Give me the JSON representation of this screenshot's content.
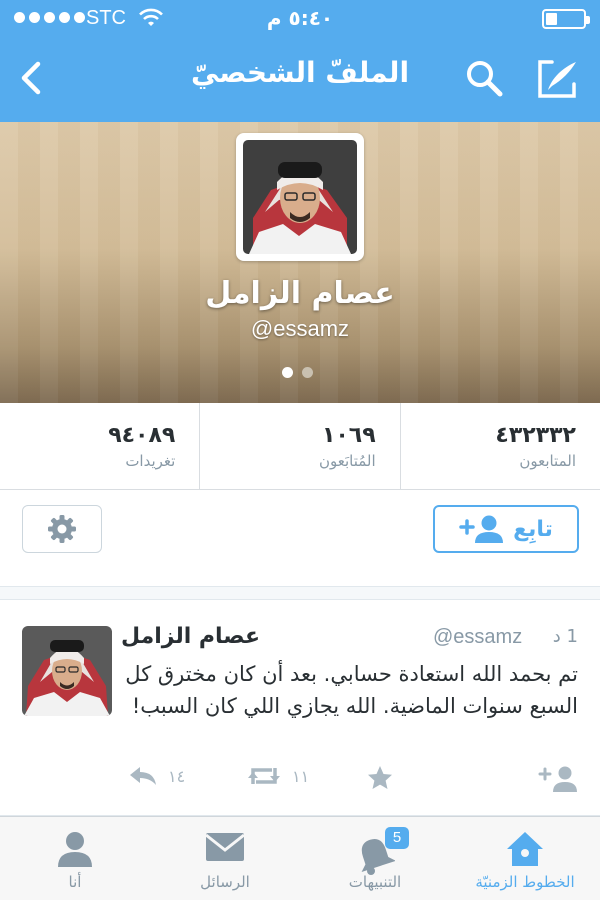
{
  "status_bar": {
    "carrier": "STC",
    "time": "٥:٤٠ م"
  },
  "nav": {
    "title": "الملفّ الشخصيّ",
    "back_icon": "chevron-left-icon",
    "search_icon": "search-icon",
    "compose_icon": "compose-icon"
  },
  "profile": {
    "display_name": "عصام الزامل",
    "handle": "@essamz",
    "pager_active_color": "#ffffff",
    "pager_inactive_color": "#c9c0b0"
  },
  "stats": [
    {
      "value": "٤٣٢٣٣٢",
      "label": "المتابعون"
    },
    {
      "value": "١٠٦٩",
      "label": "المُتابَعون"
    },
    {
      "value": "٩٤٠٨٩",
      "label": "تغريدات"
    }
  ],
  "actions": {
    "follow_label": "تابِع",
    "settings_icon": "gear-icon"
  },
  "tweet": {
    "author_name": "عصام الزامل",
    "author_handle": "@essamz",
    "time_ago": "1 د",
    "text": "تم بحمد الله استعادة حسابي. بعد أن كان مخترق كل السبع سنوات الماضية. الله يجازي اللي كان السبب!",
    "retweets": "١١",
    "replies": "١٤"
  },
  "tabbar": {
    "items": [
      {
        "label": "أنا",
        "icon": "person-icon"
      },
      {
        "label": "الرسائل",
        "icon": "envelope-icon"
      },
      {
        "label": "التنبيهات",
        "icon": "bell-icon",
        "badge": "5"
      },
      {
        "label": "الخطوط الزمنيّة",
        "icon": "home-icon",
        "active": true
      }
    ]
  },
  "colors": {
    "brand": "#55acee",
    "text": "#292f33",
    "muted": "#8899a6"
  }
}
